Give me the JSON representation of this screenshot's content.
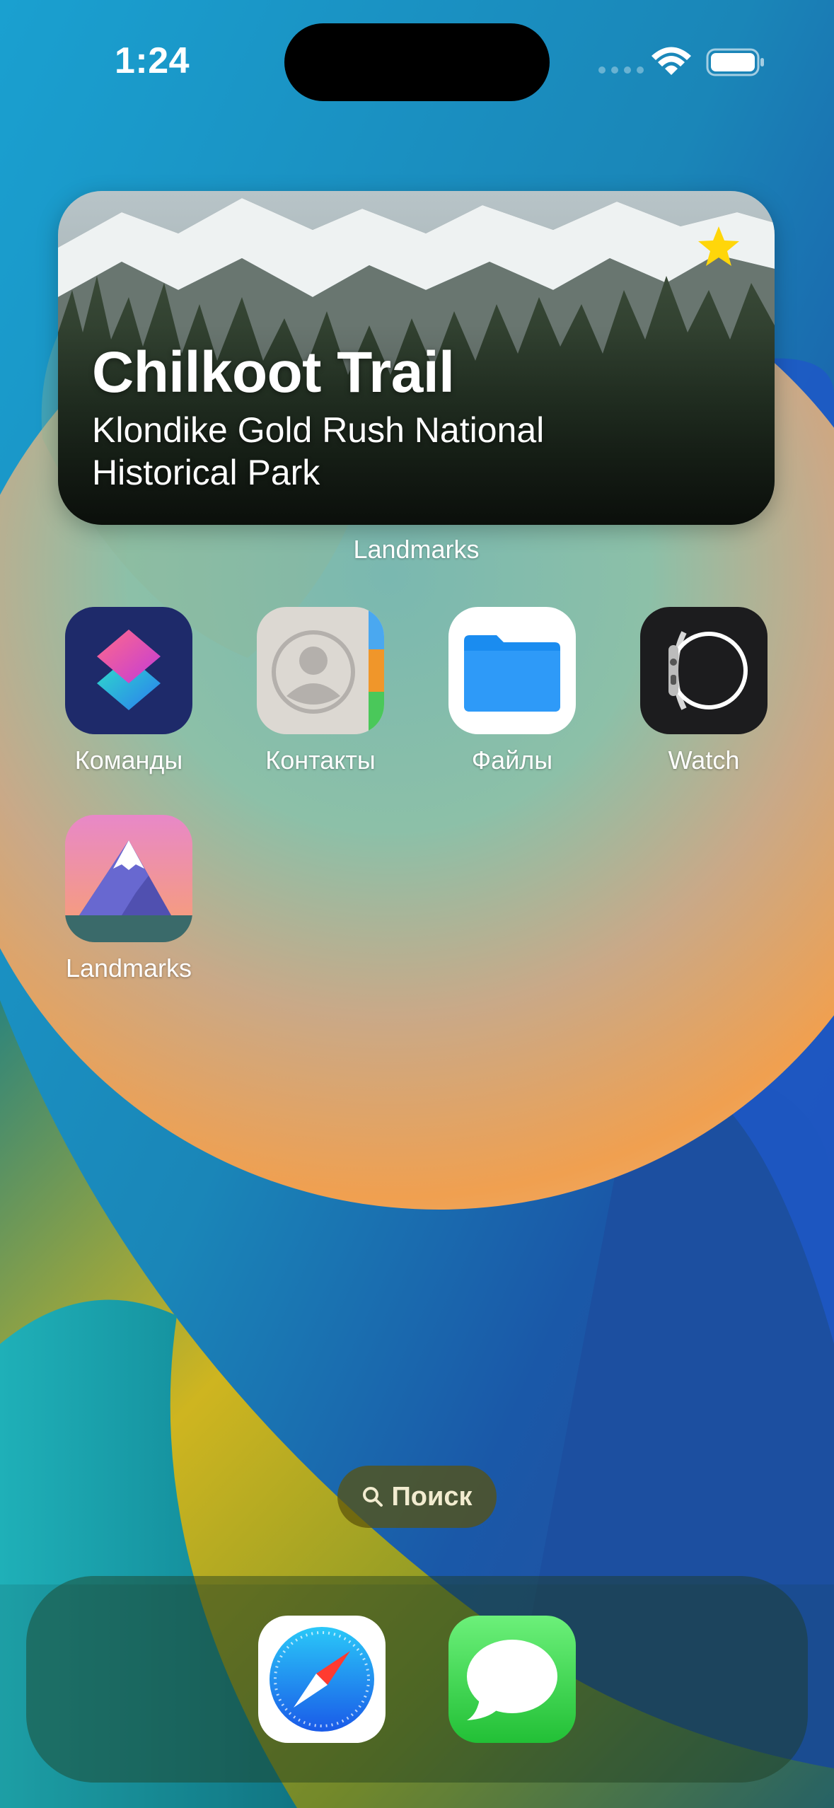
{
  "status_bar": {
    "time": "1:24",
    "icons": [
      "signal-dots",
      "wifi-icon",
      "battery-icon"
    ]
  },
  "widget": {
    "title": "Chilkoot Trail",
    "subtitle": "Klondike Gold Rush National Historical Park",
    "caption": "Landmarks",
    "favorite_icon": "star-icon",
    "star_color": "#FFD60A"
  },
  "apps": [
    {
      "label": "Команды",
      "icon": "shortcuts-icon"
    },
    {
      "label": "Контакты",
      "icon": "contacts-icon"
    },
    {
      "label": "Файлы",
      "icon": "files-icon"
    },
    {
      "label": "Watch",
      "icon": "watch-icon"
    },
    {
      "label": "Landmarks",
      "icon": "landmarks-icon"
    }
  ],
  "search": {
    "label": "Поиск",
    "icon": "search-icon"
  },
  "dock": {
    "apps": [
      {
        "icon": "safari-icon"
      },
      {
        "icon": "messages-icon"
      }
    ]
  }
}
